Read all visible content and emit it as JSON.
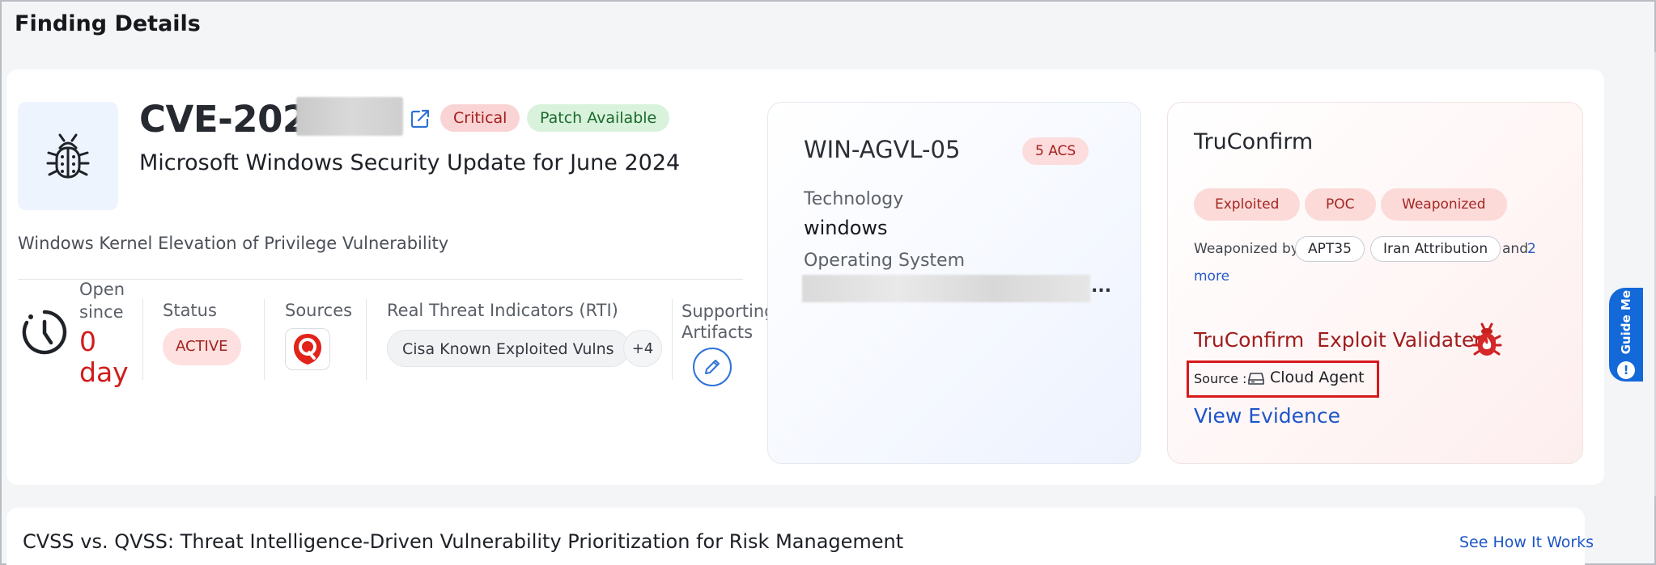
{
  "page": {
    "title": "Finding Details"
  },
  "finding": {
    "cve_prefix": "CVE-2024-",
    "severity": "Critical",
    "patch_status": "Patch Available",
    "title": "Microsoft Windows Security Update for June 2024",
    "description": "Windows Kernel Elevation of Privilege Vulnerability",
    "open_since_label": "Open since",
    "open_since_value": "0 day",
    "status_label": "Status",
    "status_value": "ACTIVE",
    "sources_label": "Sources",
    "rti_label": "Real Threat Indicators (RTI)",
    "rti_chip": "Cisa Known Exploited Vulns",
    "rti_more": "+4",
    "supporting_label": "Supporting Artifacts"
  },
  "asset": {
    "name": "WIN-AGVL-05",
    "acs_badge": "5 ACS",
    "technology_label": "Technology",
    "technology_value": "windows",
    "os_label": "Operating System",
    "os_ellipsis": "..."
  },
  "truconfirm": {
    "title": "TruConfirm",
    "tags": [
      "Exploited",
      "POC",
      "Weaponized"
    ],
    "weaponized_by_label": "Weaponized by",
    "actors": [
      "APT35",
      "Iran Attribution"
    ],
    "and_text": "and",
    "more_count": "2",
    "more_text": "more",
    "validated_label": "TruConfirm",
    "validated_text": "Exploit Validated",
    "source_label": "Source :",
    "source_value": "Cloud Agent",
    "view_evidence": "View Evidence"
  },
  "guide": {
    "label": "Guide Me",
    "dot": "!"
  },
  "bottom": {
    "title": "CVSS vs. QVSS: Threat Intelligence-Driven Vulnerability Prioritization for Risk Management",
    "link": "See How It Works"
  },
  "colors": {
    "critical": "#d11c1c",
    "link": "#1d55c8",
    "truconfirm_red": "#9f1d1d",
    "highlight_box": "#d7191c",
    "guide_blue": "#1469d8"
  }
}
